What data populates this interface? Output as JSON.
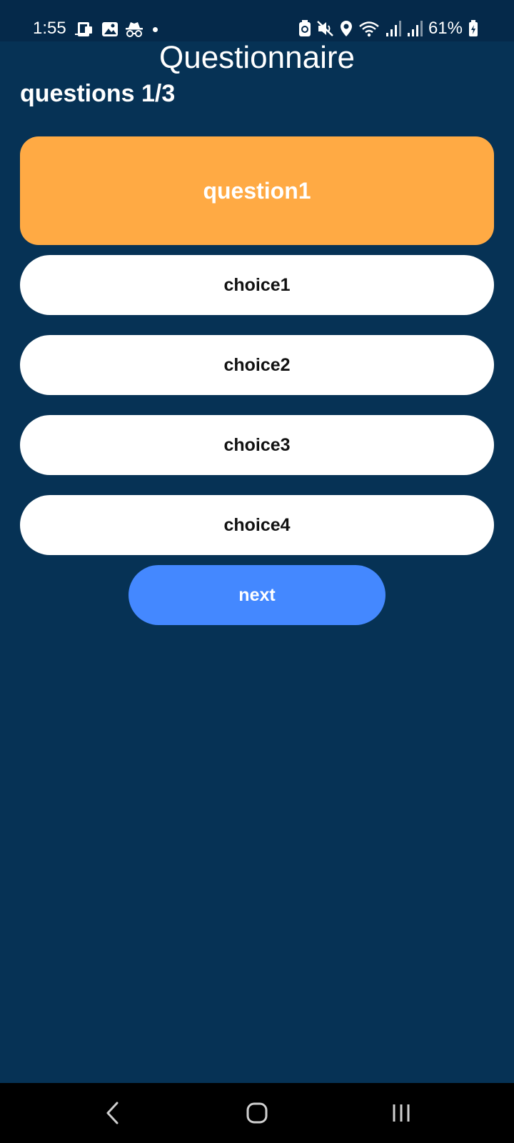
{
  "status_bar": {
    "time": "1:55",
    "battery_percent": "61%",
    "left_icons": [
      "device-icon",
      "gallery-icon",
      "incognito-icon",
      "notification-dot"
    ],
    "right_icons": [
      "battery-saver-icon",
      "mute-icon",
      "location-icon",
      "wifi-icon",
      "signal-icon",
      "signal-icon",
      "battery-icon"
    ]
  },
  "header": {
    "title": "Questionnaire",
    "progress": "questions 1/3"
  },
  "question": {
    "text": "question1",
    "color": "#ffaa44"
  },
  "choices": [
    {
      "label": "choice1"
    },
    {
      "label": "choice2"
    },
    {
      "label": "choice3"
    },
    {
      "label": "choice4"
    }
  ],
  "next_button": {
    "label": "next",
    "color": "#4488ff"
  },
  "nav_bar": {
    "buttons": [
      "back-icon",
      "home-icon",
      "recents-icon"
    ]
  },
  "colors": {
    "background": "#063255",
    "status_bar": "#05294a",
    "choice_bg": "#ffffff"
  }
}
